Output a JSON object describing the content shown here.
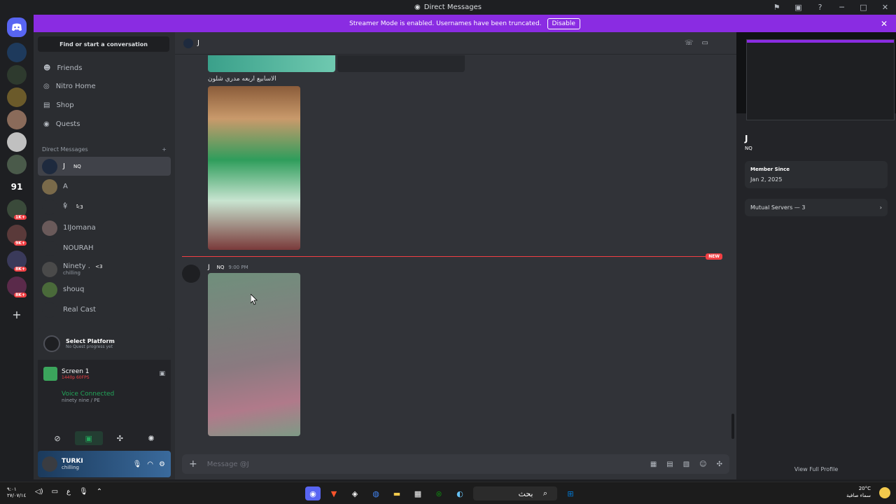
{
  "window": {
    "title": "Direct Messages"
  },
  "banner": {
    "text": "Streamer Mode is enabled. Usernames have been truncated.",
    "button": "Disable"
  },
  "sidebar": {
    "search": "Find or start a conversation",
    "nav": [
      "Friends",
      "Nitro Home",
      "Shop",
      "Quests"
    ],
    "dm_header": "Direct Messages",
    "dms": [
      {
        "name": "J",
        "tag": "NQ",
        "sub": ""
      },
      {
        "name": "A",
        "tag": "",
        "sub": ""
      },
      {
        "name": "ٌ¥",
        "tag": "ٌٌ<3",
        "sub": ""
      },
      {
        "name": "1IJomana",
        "tag": "",
        "sub": ""
      },
      {
        "name": "NOURAH",
        "tag": "",
        "sub": ""
      },
      {
        "name": "Ninety .",
        "tag": "<3",
        "sub": "chilling"
      },
      {
        "name": "shouq",
        "tag": "",
        "sub": ""
      },
      {
        "name": "Real Cast",
        "tag": "",
        "sub": ""
      }
    ],
    "quest": {
      "title": "Select Platform",
      "sub": "No Quest progress yet"
    },
    "stream": {
      "title": "Screen 1",
      "sub": "1440p 60FPS"
    },
    "voice": {
      "title": "Voice Connected",
      "sub": "ninety nine / PE"
    },
    "user": {
      "name": "TURKI",
      "status": "chilling"
    }
  },
  "guild_badges": [
    "1K+",
    "9K+",
    "8K+",
    "8K+"
  ],
  "guild_text": "91",
  "chat": {
    "header": "J",
    "caption": "الاسابيع اربعه مدري شلون",
    "new_label": "NEW",
    "message": {
      "author": "J",
      "tag": "NQ",
      "time": "9:00 PM"
    },
    "composer_placeholder": "Message @J"
  },
  "profile": {
    "name": "J",
    "tag": "NQ",
    "member_since_label": "Member Since",
    "member_since": "Jan 2, 2025",
    "mutual_servers": "Mutual Servers — 3",
    "view_full": "View Full Profile"
  },
  "taskbar": {
    "time": "٩:٠١",
    "date": "٢٧/٠٧/١٤",
    "search": "بحث",
    "weather_temp": "20°C",
    "weather_desc": "سماء صافية",
    "lang": "ع"
  }
}
